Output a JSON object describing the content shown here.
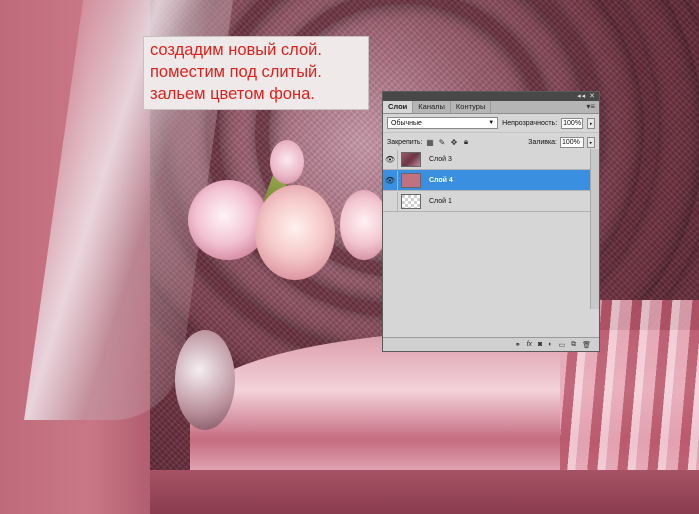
{
  "annotation": {
    "lines": [
      "создадим новый слой.",
      "поместим под слитый.",
      "зальем цветом фона."
    ]
  },
  "layers_panel": {
    "tabs": [
      "Слои",
      "Каналы",
      "Контуры"
    ],
    "active_tab": "Слои",
    "blend_mode": "Обычные",
    "opacity_label": "Непрозрачность:",
    "opacity_value": "100%",
    "lock_label": "Закрепить:",
    "fill_label": "Заливка:",
    "fill_value": "100%",
    "layers": [
      {
        "name": "Слой 3",
        "visible": true,
        "selected": false
      },
      {
        "name": "Слой 4",
        "visible": true,
        "selected": true
      },
      {
        "name": "Слой 1",
        "visible": false,
        "selected": false
      }
    ],
    "selection_color": "#3a8fe0",
    "layer4_fill_color": "#c27180",
    "bottom_icons": [
      "link-icon",
      "fx-icon",
      "mask-icon",
      "adjustment-icon",
      "group-icon",
      "new-layer-icon",
      "trash-icon"
    ]
  },
  "colors": {
    "annotation_text": "#e0201b",
    "annotation_background": "#efe9e9"
  }
}
